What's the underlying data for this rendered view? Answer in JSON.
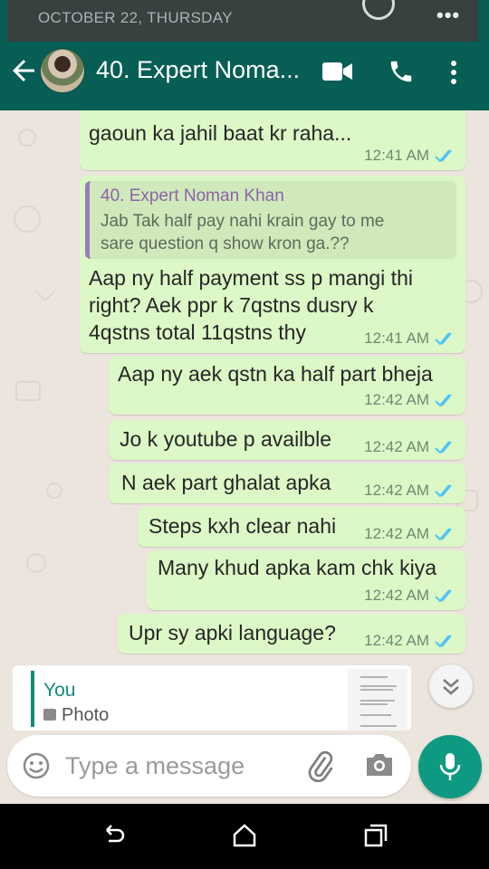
{
  "notification": {
    "date": "OCTOBER 22, THURSDAY"
  },
  "header": {
    "contact_name": "40. Expert Noma..."
  },
  "messages": [
    {
      "text": "gaoun ka jahil baat kr raha...",
      "time": "12:41 AM"
    },
    {
      "quote": {
        "author": "40. Expert Noman Khan",
        "line1": "Jab Tak half pay nahi krain gay to me",
        "line2": "sare question q show kron ga.??"
      },
      "line1": "Aap ny half payment ss p mangi thi",
      "line2": "right? Aek ppr k 7qstns dusry k",
      "line3": "4qstns total 11qstns thy",
      "time": "12:41 AM"
    },
    {
      "text": "Aap ny aek qstn ka half part bheja",
      "time": "12:42 AM"
    },
    {
      "text": "Jo k youtube p availble",
      "time": "12:42 AM"
    },
    {
      "text": "N aek part ghalat apka",
      "time": "12:42 AM"
    },
    {
      "text": "Steps kxh clear nahi",
      "time": "12:42 AM"
    },
    {
      "text": "Many khud apka kam chk kiya",
      "time": "12:42 AM"
    },
    {
      "text": "Upr sy apki language?",
      "time": "12:42 AM"
    }
  ],
  "reply_preview": {
    "sender": "You",
    "type": "Photo"
  },
  "composer": {
    "placeholder": "Type a message"
  },
  "colors": {
    "header": "#075e54",
    "bubble_out": "#dcf8c6",
    "read_ticks": "#4fc3f7",
    "fab": "#0e9a82"
  }
}
